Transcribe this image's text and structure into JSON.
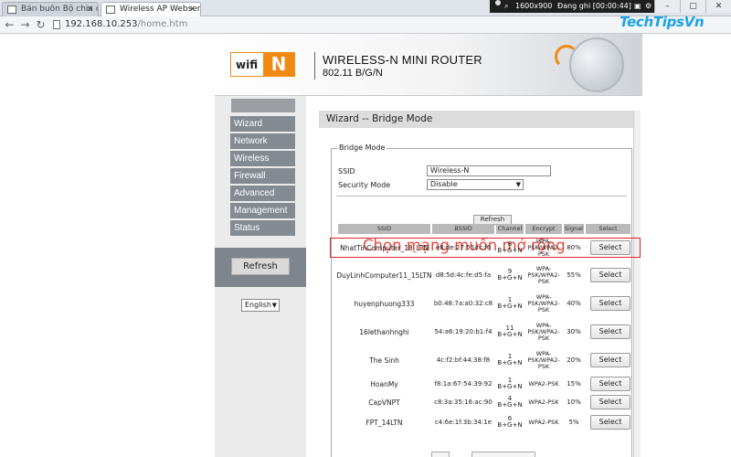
{
  "browser": {
    "tabs": [
      {
        "title": "Bán buôn Bộ chia cổng ti..."
      },
      {
        "title": "Wireless AP Webserver"
      }
    ],
    "url_host": "192.168.10.253",
    "url_path": "/home.htm",
    "recorder": {
      "resolution": "1600x900",
      "status": "Đang ghi [00:00:44]"
    },
    "close_icon": "×"
  },
  "watermark": "TechTipsVn",
  "router": {
    "logo_wifi": "wifi",
    "logo_n": "N",
    "title": "WIRELESS-N MINI ROUTER",
    "subtitle": "802.11 B/G/N",
    "menu": [
      "Wizard",
      "Network",
      "Wireless",
      "Firewall",
      "Advanced",
      "Management",
      "Status"
    ],
    "side_refresh": "Refresh",
    "language": "English",
    "page_title": "Wizard -- Bridge Mode",
    "legend": "Bridge Mode",
    "ssid_label": "SSID",
    "ssid_value": "Wireless-N",
    "security_label": "Security Mode",
    "security_value": "Disable",
    "refresh_label": "Refresh",
    "annotation": "Chọn mạng muốn mở rộng",
    "table_headers": [
      "SSID",
      "BSSID",
      "Channel",
      "Encrypt",
      "Signal",
      "Select"
    ],
    "rows": [
      {
        "ssid": "NhatTinComputer_18_LTN",
        "bssid": "e8:de:27:55:fc:f6",
        "ch1": "6",
        "ch2": "B+G+N",
        "enc1": "WPA-",
        "enc2": "PSK/WPA2-",
        "enc3": "PSK",
        "signal": "80%",
        "select": "Select"
      },
      {
        "ssid": "DuyLinhComputer11_15LTN",
        "bssid": "d8:5d:4c:fe:d5:fa",
        "ch1": "9",
        "ch2": "B+G+N",
        "enc1": "WPA-",
        "enc2": "PSK/WPA2-",
        "enc3": "PSK",
        "signal": "55%",
        "select": "Select"
      },
      {
        "ssid": "huyenphuong333",
        "bssid": "b0:48:7a:a0:32:c8",
        "ch1": "1",
        "ch2": "B+G+N",
        "enc1": "WPA-",
        "enc2": "PSK/WPA2-",
        "enc3": "PSK",
        "signal": "40%",
        "select": "Select"
      },
      {
        "ssid": "16lethanhnghi",
        "bssid": "54:a6:19:20:b1:f4",
        "ch1": "11",
        "ch2": "B+G+N",
        "enc1": "WPA-",
        "enc2": "PSK/WPA2-",
        "enc3": "PSK",
        "signal": "30%",
        "select": "Select"
      },
      {
        "ssid": "The Sinh",
        "bssid": "4c:f2:bf:44:38:f8",
        "ch1": "1",
        "ch2": "B+G+N",
        "enc1": "WPA-",
        "enc2": "PSK/WPA2-",
        "enc3": "PSK",
        "signal": "20%",
        "select": "Select"
      },
      {
        "ssid": "HoanMy",
        "bssid": "f8:1a:67:54:39:92",
        "ch1": "1",
        "ch2": "B+G+N",
        "enc1": "",
        "enc2": "WPA2-PSK",
        "enc3": "",
        "signal": "15%",
        "select": "Select"
      },
      {
        "ssid": "CapVNPT",
        "bssid": "c8:3a:35:16:ac:90",
        "ch1": "4",
        "ch2": "B+G+N",
        "enc1": "",
        "enc2": "WPA2-PSK",
        "enc3": "",
        "signal": "10%",
        "select": "Select"
      },
      {
        "ssid": "FPT_14LTN",
        "bssid": "c4:6e:1f:3b:34:1e",
        "ch1": "6",
        "ch2": "B+G+N",
        "enc1": "",
        "enc2": "WPA2-PSK",
        "enc3": "",
        "signal": "5%",
        "select": "Select"
      }
    ]
  }
}
